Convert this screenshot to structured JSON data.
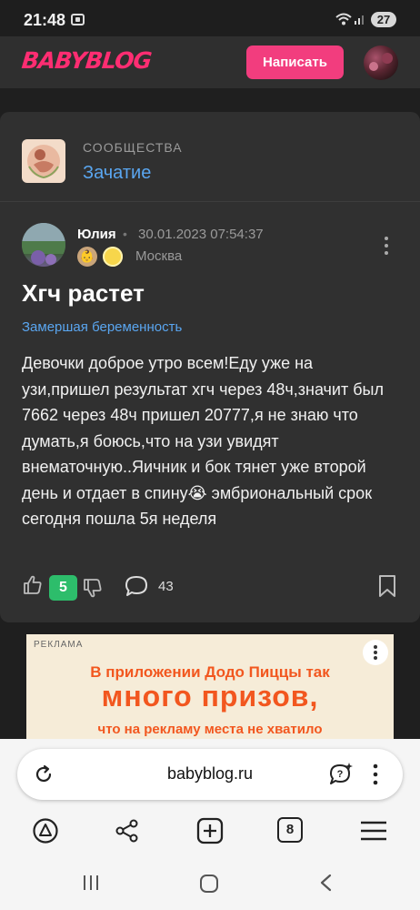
{
  "status_bar": {
    "time": "21:48",
    "battery": "27"
  },
  "header": {
    "logo": "BABYBLOG",
    "write_button": "Написать"
  },
  "community": {
    "caption": "СООБЩЕСТВА",
    "name": "Зачатие"
  },
  "post": {
    "author": "Юлия",
    "date": "30.01.2023 07:54:37",
    "city": "Москва",
    "title": "Хгч растет",
    "tag": "Замершая беременность",
    "body": "Девочки доброе утро всем!Еду уже на узи,пришел результат хгч через 48ч,значит был 7662 через 48ч пришел 20777,я не знаю что думать,я боюсь,что на узи увидят внематочную..Яичник и бок тянет уже второй день и отдает в спину😭 эмбриональный срок сегодня пошла 5я неделя",
    "score": "5",
    "comments": "43"
  },
  "ad": {
    "label": "РЕКЛАМА",
    "line1": "В приложении Додо Пиццы так",
    "line2": "много призов,",
    "line3": "что на рекламу места не хватило"
  },
  "browser": {
    "url": "babyblog.ru",
    "tabs": "8"
  },
  "colors": {
    "accent_pink": "#f23d7e",
    "link_blue": "#5aa6f0",
    "score_green": "#2dbd6b",
    "ad_orange": "#f2571f"
  }
}
